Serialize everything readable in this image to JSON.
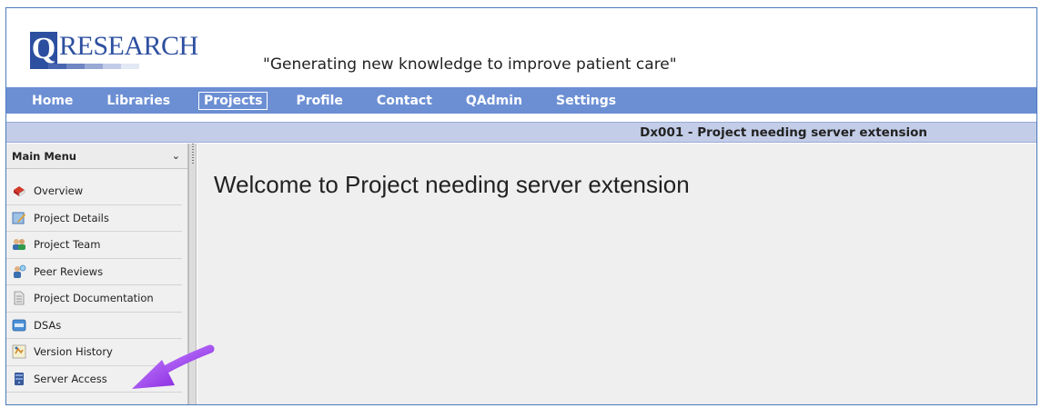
{
  "header": {
    "logo_q": "Q",
    "logo_text": "RESEARCH",
    "tagline": "\"Generating new knowledge to improve patient care\""
  },
  "nav": {
    "items": [
      {
        "label": "Home",
        "active": false
      },
      {
        "label": "Libraries",
        "active": false
      },
      {
        "label": "Projects",
        "active": true
      },
      {
        "label": "Profile",
        "active": false
      },
      {
        "label": "Contact",
        "active": false
      },
      {
        "label": "QAdmin",
        "active": false
      },
      {
        "label": "Settings",
        "active": false
      }
    ]
  },
  "project_bar": {
    "title": "Dx001 - Project needing server extension"
  },
  "sidebar": {
    "header": "Main Menu",
    "items": [
      {
        "label": "Overview",
        "icon": "overview-icon"
      },
      {
        "label": "Project Details",
        "icon": "project-details-icon"
      },
      {
        "label": "Project Team",
        "icon": "team-icon"
      },
      {
        "label": "Peer Reviews",
        "icon": "peer-review-icon"
      },
      {
        "label": "Project Documentation",
        "icon": "document-icon"
      },
      {
        "label": "DSAs",
        "icon": "dsa-icon"
      },
      {
        "label": "Version History",
        "icon": "version-history-icon"
      },
      {
        "label": "Server Access",
        "icon": "server-icon"
      }
    ]
  },
  "main": {
    "welcome": "Welcome to Project needing server extension"
  },
  "colors": {
    "nav_bg": "#6c8fd4",
    "project_bar_bg": "#c3cde8",
    "logo_blue": "#2d4fa0",
    "arrow": "#a64ff0"
  }
}
